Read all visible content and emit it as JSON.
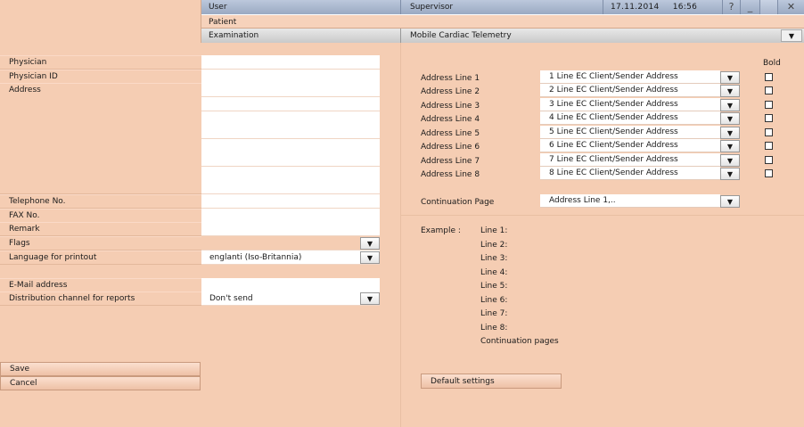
{
  "header": {
    "user_label": "User",
    "supervisor_label": "Supervisor",
    "date": "17.11.2014",
    "time": "16:56",
    "help_glyph": "?",
    "minimize_glyph": "_",
    "close_glyph": "✕"
  },
  "nav": {
    "patient_label": "Patient",
    "examination_label": "Examination",
    "mode_value": "Mobile Cardiac Telemetry",
    "dropdown_glyph": "▼"
  },
  "left_form": {
    "physician": "Physician",
    "physician_id": "Physician ID",
    "address": "Address",
    "telephone": "Telephone No.",
    "fax": "FAX No.",
    "remark": "Remark",
    "flags": "Flags",
    "language": "Language for printout",
    "language_value": "englanti (Iso-Britannia)",
    "email": "E-Mail address",
    "distribution": "Distribution channel for reports",
    "distribution_value": "Don't send",
    "save": "Save",
    "cancel": "Cancel"
  },
  "right_form": {
    "bold_header": "Bold",
    "address_lines": [
      {
        "label": "Address Line 1",
        "value": "1 Line EC Client/Sender Address"
      },
      {
        "label": "Address Line 2",
        "value": "2 Line EC Client/Sender Address"
      },
      {
        "label": "Address Line 3",
        "value": "3 Line EC Client/Sender Address"
      },
      {
        "label": "Address Line 4",
        "value": "4 Line EC Client/Sender Address"
      },
      {
        "label": "Address Line 5",
        "value": "5 Line EC Client/Sender Address"
      },
      {
        "label": "Address Line 6",
        "value": "6 Line EC Client/Sender Address"
      },
      {
        "label": "Address Line 7",
        "value": "7 Line EC Client/Sender Address"
      },
      {
        "label": "Address Line 8",
        "value": "8 Line EC Client/Sender Address"
      }
    ],
    "continuation_label": "Continuation Page",
    "continuation_value": "Address Line 1,..",
    "example_label": "Example :",
    "example_lines": [
      "Line 1:",
      "Line 2:",
      "Line 3:",
      "Line 4:",
      "Line 5:",
      "Line 6:",
      "Line 7:",
      "Line 8:",
      "Continuation pages"
    ],
    "default_settings": "Default settings"
  }
}
